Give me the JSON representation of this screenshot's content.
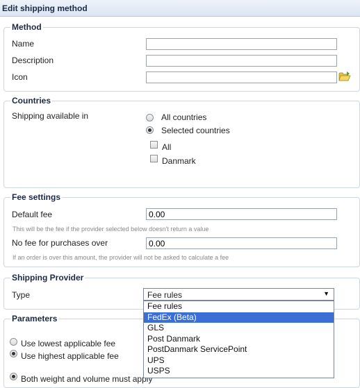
{
  "window": {
    "title": "Edit shipping method"
  },
  "method": {
    "legend": "Method",
    "name_label": "Name",
    "name_value": "",
    "description_label": "Description",
    "description_value": "",
    "icon_label": "Icon",
    "icon_value": ""
  },
  "countries": {
    "legend": "Countries",
    "available_label": "Shipping available in",
    "radio_all": "All countries",
    "radio_selected": "Selected countries",
    "cb_all": "All",
    "cb_danmark": "Danmark"
  },
  "fee": {
    "legend": "Fee settings",
    "default_label": "Default fee",
    "default_value": "0.00",
    "default_hint": "This will be the fee if the provider selected below doesn't return a value",
    "nofee_label": "No fee for purchases over",
    "nofee_value": "0.00",
    "nofee_hint": "If an order is over this amount, the provider will not be asked to calculate a fee"
  },
  "provider": {
    "legend": "Shipping Provider",
    "type_label": "Type",
    "selected": "Fee rules",
    "options": [
      "Fee rules",
      "FedEx (Beta)",
      "GLS",
      "Post Danmark",
      "PostDanmark ServicePoint",
      "UPS",
      "USPS"
    ],
    "highlighted": "FedEx (Beta)"
  },
  "parameters": {
    "legend": "Parameters",
    "opt_lowest": "Use lowest applicable fee",
    "opt_highest": "Use highest applicable fee",
    "opt_both": "Both weight and volume must apply"
  },
  "colors": {
    "highlight": "#3b6fd6",
    "border": "#cfd6df",
    "title_bar": "#dbe5f4"
  }
}
